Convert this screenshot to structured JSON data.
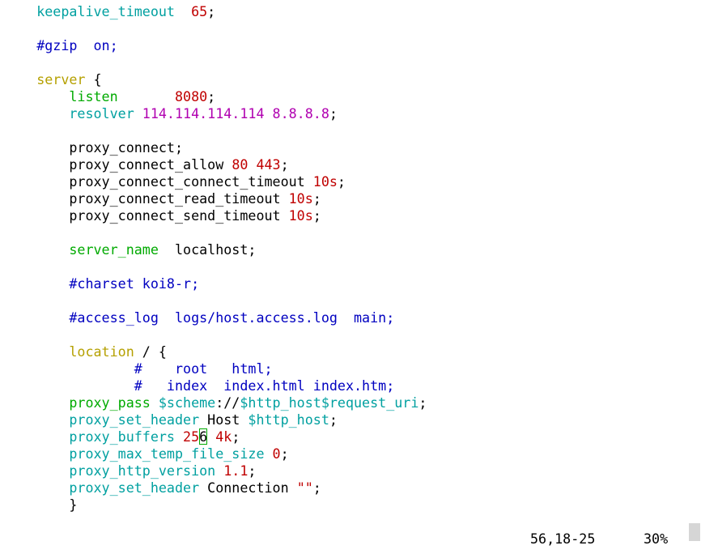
{
  "colors": {
    "directive": "#00a0a0",
    "green_directive": "#00aa00",
    "keyword": "#b5a000",
    "number": "#c00000",
    "string_ip": "#b000b0",
    "comment": "#0000c0",
    "variable": "#00a0a0",
    "text": "#000000",
    "cursor": "#00aa00"
  },
  "lines": [
    {
      "tokens": [
        {
          "t": "    ",
          "k": "text"
        },
        {
          "t": "keepalive_timeout",
          "k": "directive"
        },
        {
          "t": "  ",
          "k": "text"
        },
        {
          "t": "65",
          "k": "number"
        },
        {
          "t": ";",
          "k": "text"
        }
      ]
    },
    {
      "tokens": []
    },
    {
      "tokens": [
        {
          "t": "    ",
          "k": "text"
        },
        {
          "t": "#gzip  on;",
          "k": "comment"
        }
      ]
    },
    {
      "tokens": []
    },
    {
      "tokens": [
        {
          "t": "    ",
          "k": "text"
        },
        {
          "t": "server",
          "k": "keyword"
        },
        {
          "t": " {",
          "k": "text"
        }
      ]
    },
    {
      "tokens": [
        {
          "t": "        ",
          "k": "text"
        },
        {
          "t": "listen",
          "k": "green_directive"
        },
        {
          "t": "       ",
          "k": "text"
        },
        {
          "t": "8080",
          "k": "number"
        },
        {
          "t": ";",
          "k": "text"
        }
      ]
    },
    {
      "tokens": [
        {
          "t": "        ",
          "k": "text"
        },
        {
          "t": "resolver",
          "k": "directive"
        },
        {
          "t": " ",
          "k": "text"
        },
        {
          "t": "114.114.114.114",
          "k": "string_ip"
        },
        {
          "t": " ",
          "k": "text"
        },
        {
          "t": "8.8.8.8",
          "k": "string_ip"
        },
        {
          "t": ";",
          "k": "text"
        }
      ]
    },
    {
      "tokens": []
    },
    {
      "tokens": [
        {
          "t": "        proxy_connect;",
          "k": "text"
        }
      ]
    },
    {
      "tokens": [
        {
          "t": "        proxy_connect_allow ",
          "k": "text"
        },
        {
          "t": "80",
          "k": "number"
        },
        {
          "t": " ",
          "k": "text"
        },
        {
          "t": "443",
          "k": "number"
        },
        {
          "t": ";",
          "k": "text"
        }
      ]
    },
    {
      "tokens": [
        {
          "t": "        proxy_connect_connect_timeout ",
          "k": "text"
        },
        {
          "t": "10s",
          "k": "number"
        },
        {
          "t": ";",
          "k": "text"
        }
      ]
    },
    {
      "tokens": [
        {
          "t": "        proxy_connect_read_timeout ",
          "k": "text"
        },
        {
          "t": "10s",
          "k": "number"
        },
        {
          "t": ";",
          "k": "text"
        }
      ]
    },
    {
      "tokens": [
        {
          "t": "        proxy_connect_send_timeout ",
          "k": "text"
        },
        {
          "t": "10s",
          "k": "number"
        },
        {
          "t": ";",
          "k": "text"
        }
      ]
    },
    {
      "tokens": []
    },
    {
      "tokens": [
        {
          "t": "        ",
          "k": "text"
        },
        {
          "t": "server_name",
          "k": "green_directive"
        },
        {
          "t": "  localhost;",
          "k": "text"
        }
      ]
    },
    {
      "tokens": []
    },
    {
      "tokens": [
        {
          "t": "        ",
          "k": "text"
        },
        {
          "t": "#charset koi8-r;",
          "k": "comment"
        }
      ]
    },
    {
      "tokens": []
    },
    {
      "tokens": [
        {
          "t": "        ",
          "k": "text"
        },
        {
          "t": "#access_log  logs/host.access.log  main;",
          "k": "comment"
        }
      ]
    },
    {
      "tokens": []
    },
    {
      "tokens": [
        {
          "t": "        ",
          "k": "text"
        },
        {
          "t": "location",
          "k": "keyword"
        },
        {
          "t": " / {",
          "k": "text"
        }
      ]
    },
    {
      "tokens": [
        {
          "t": "                ",
          "k": "text"
        },
        {
          "t": "#    root   html;",
          "k": "comment"
        }
      ]
    },
    {
      "tokens": [
        {
          "t": "                ",
          "k": "text"
        },
        {
          "t": "#   index  index.html index.htm;",
          "k": "comment"
        }
      ]
    },
    {
      "tokens": [
        {
          "t": "        ",
          "k": "text"
        },
        {
          "t": "proxy_pass",
          "k": "green_directive"
        },
        {
          "t": " ",
          "k": "text"
        },
        {
          "t": "$scheme",
          "k": "variable"
        },
        {
          "t": "://",
          "k": "text"
        },
        {
          "t": "$http_host",
          "k": "variable"
        },
        {
          "t": "$request_uri",
          "k": "variable"
        },
        {
          "t": ";",
          "k": "text"
        }
      ]
    },
    {
      "tokens": [
        {
          "t": "        ",
          "k": "text"
        },
        {
          "t": "proxy_set_header",
          "k": "directive"
        },
        {
          "t": " Host ",
          "k": "text"
        },
        {
          "t": "$http_host",
          "k": "variable"
        },
        {
          "t": ";",
          "k": "text"
        }
      ]
    },
    {
      "tokens": [
        {
          "t": "        ",
          "k": "text"
        },
        {
          "t": "proxy_buffers",
          "k": "directive"
        },
        {
          "t": " ",
          "k": "text"
        },
        {
          "t": "25",
          "k": "number"
        },
        {
          "t": "6",
          "k": "text",
          "cursor": true
        },
        {
          "t": " ",
          "k": "text"
        },
        {
          "t": "4k",
          "k": "number"
        },
        {
          "t": ";",
          "k": "text"
        }
      ]
    },
    {
      "tokens": [
        {
          "t": "        ",
          "k": "text"
        },
        {
          "t": "proxy_max_temp_file_size",
          "k": "directive"
        },
        {
          "t": " ",
          "k": "text"
        },
        {
          "t": "0",
          "k": "number"
        },
        {
          "t": ";",
          "k": "text"
        }
      ]
    },
    {
      "tokens": [
        {
          "t": "        ",
          "k": "text"
        },
        {
          "t": "proxy_http_version",
          "k": "directive"
        },
        {
          "t": " ",
          "k": "text"
        },
        {
          "t": "1.1",
          "k": "number"
        },
        {
          "t": ";",
          "k": "text"
        }
      ]
    },
    {
      "tokens": [
        {
          "t": "        ",
          "k": "text"
        },
        {
          "t": "proxy_set_header",
          "k": "directive"
        },
        {
          "t": " Connection ",
          "k": "text"
        },
        {
          "t": "\"\"",
          "k": "number"
        },
        {
          "t": ";",
          "k": "text"
        }
      ]
    },
    {
      "tokens": [
        {
          "t": "        }",
          "k": "text"
        }
      ]
    }
  ],
  "status": {
    "position": "56,18-25",
    "percent": "30%"
  }
}
